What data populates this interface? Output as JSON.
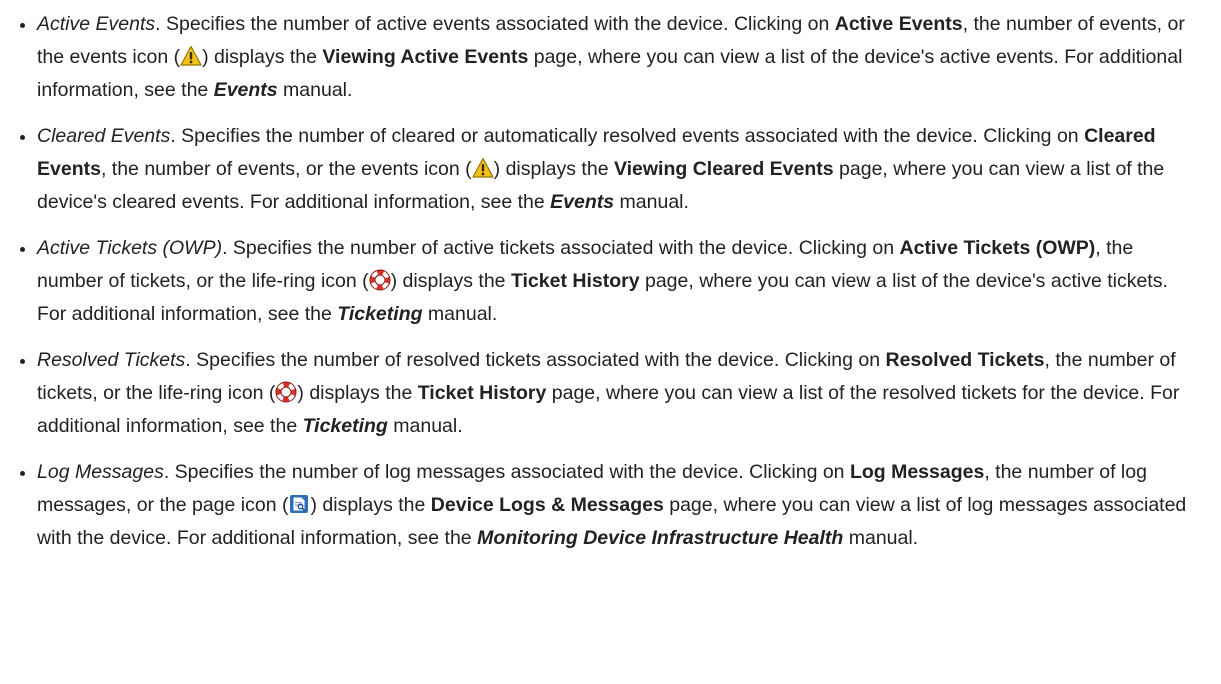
{
  "items": [
    {
      "term": "Active Events",
      "p1": ". Specifies the number of active events associated with the device. Clicking on ",
      "b1": "Active Events",
      "p2": ", the number of events, or the events icon (",
      "p3": ") displays the ",
      "b2": "Viewing Active Events",
      "p4": " page, where you can view a list of the device's active events. For additional information, see the ",
      "manual": "Events",
      "p5": " manual.",
      "icon": "warning-icon"
    },
    {
      "term": "Cleared Events",
      "p1": ". Specifies the number of cleared or automatically resolved events associated with the device. Clicking on ",
      "b1": "Cleared Events",
      "p2": ", the number of events, or the events icon (",
      "p3": ") displays the ",
      "b2": "Viewing Cleared Events",
      "p4": " page, where you can view a list of the device's cleared events. For additional information, see the ",
      "manual": "Events",
      "p5": " manual.",
      "icon": "warning-icon"
    },
    {
      "term": "Active Tickets (OWP)",
      "p1": ". Specifies the number of active tickets associated with the device. Clicking on ",
      "b1": "Active Tickets (OWP)",
      "p2": ", the number of tickets, or the life-ring icon (",
      "p3": ") displays the ",
      "b2": "Ticket History",
      "p4": " page, where you can view a list of the device's active tickets. For additional information, see the ",
      "manual": "Ticketing",
      "p5": " manual.",
      "icon": "life-ring-icon"
    },
    {
      "term": "Resolved Tickets",
      "p1": ". Specifies the number of resolved tickets associated with the device. Clicking on ",
      "b1": "Resolved Tickets",
      "p2": ", the number of tickets, or the life-ring icon (",
      "p3": ") displays the ",
      "b2": "Ticket History",
      "p4": " page, where you can view a list of the resolved tickets for the device. For additional information, see the ",
      "manual": "Ticketing",
      "p5": " manual.",
      "icon": "life-ring-icon"
    },
    {
      "term": "Log Messages",
      "p1": ". Specifies the number of log messages associated with the device. Clicking on ",
      "b1": "Log Messages",
      "p2": ", the number of log messages, or the page icon (",
      "p3": ") displays the ",
      "b2": "Device Logs & Messages",
      "p4": " page, where you can view a list of log messages associated with the device. For additional information, see the ",
      "manual": "Monitoring Device Infrastructure Health",
      "p5": " manual.",
      "icon": "page-icon"
    }
  ],
  "colors": {
    "text": "#222222",
    "warning": "#f2c21b",
    "life_ring": "#d8322a",
    "page_icon": "#2f6db5"
  }
}
